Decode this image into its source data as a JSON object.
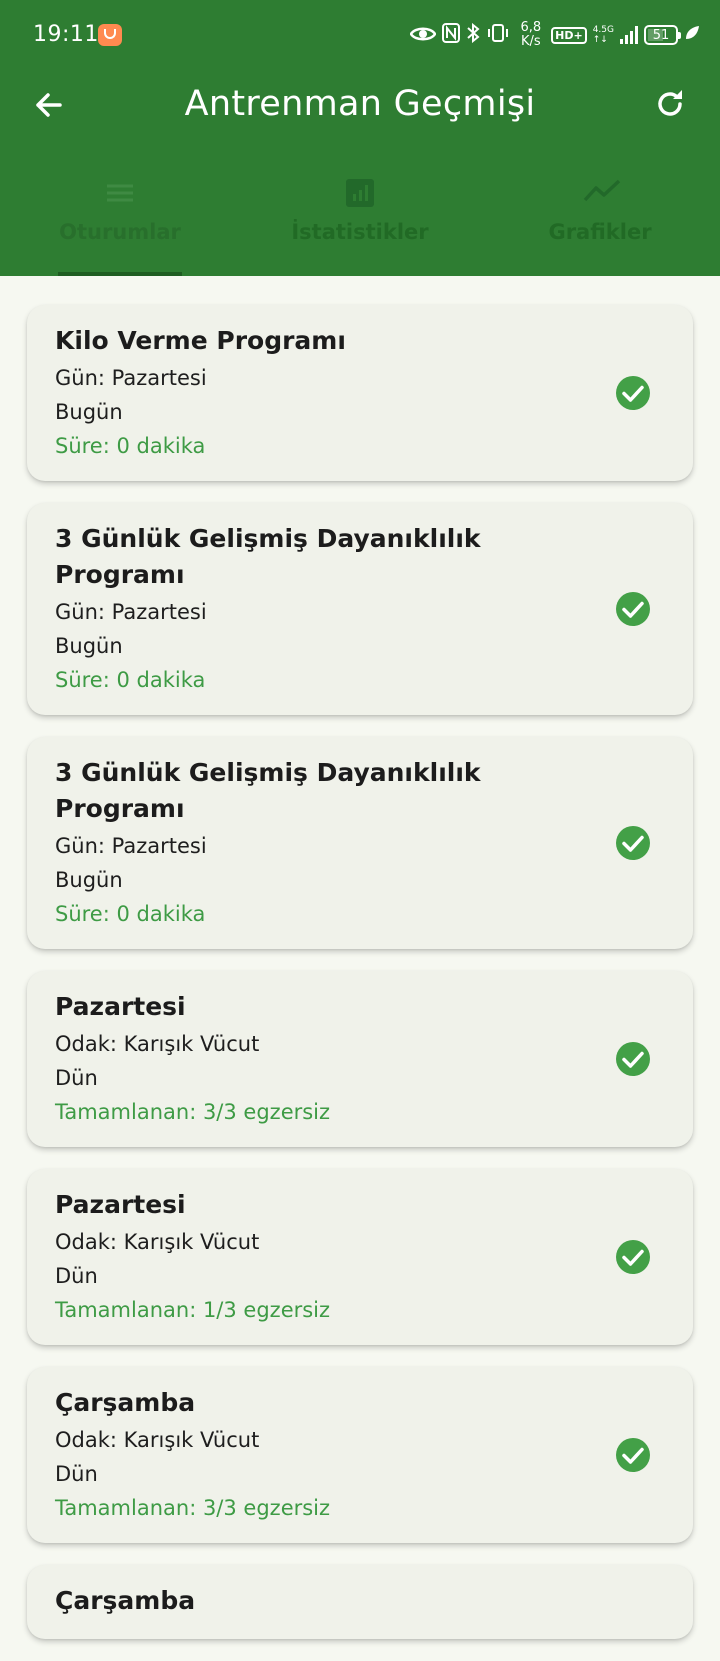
{
  "status_bar": {
    "time": "19:11",
    "speed_value": "6,8",
    "speed_unit": "K/s",
    "hd": "HD+",
    "network_top": "4.5G",
    "network_bottom": "↑↓",
    "battery": "51"
  },
  "header": {
    "title": "Antrenman Geçmişi",
    "back_icon": "arrow-back-icon",
    "refresh_icon": "refresh-icon",
    "background": "#2e7d32"
  },
  "tabs": [
    {
      "label": "Oturumlar",
      "icon": "list-icon",
      "selected": true
    },
    {
      "label": "İstatistikler",
      "icon": "bar-chart-icon",
      "selected": false
    },
    {
      "label": "Grafikler",
      "icon": "trend-line-icon",
      "selected": false
    }
  ],
  "sessions": [
    {
      "title": "Kilo Verme Programı",
      "line1": "Gün: Pazartesi",
      "line2": "Bugün",
      "detail": "Süre: 0 dakika",
      "completed": true
    },
    {
      "title": "3 Günlük Gelişmiş Dayanıklılık Programı",
      "line1": "Gün: Pazartesi",
      "line2": "Bugün",
      "detail": "Süre: 0 dakika",
      "completed": true
    },
    {
      "title": "3 Günlük Gelişmiş Dayanıklılık Programı",
      "line1": "Gün: Pazartesi",
      "line2": "Bugün",
      "detail": "Süre: 0 dakika",
      "completed": true
    },
    {
      "title": "Pazartesi",
      "line1": "Odak: Karışık Vücut",
      "line2": "Dün",
      "detail": "Tamamlanan: 3/3 egzersiz",
      "completed": true
    },
    {
      "title": "Pazartesi",
      "line1": "Odak: Karışık Vücut",
      "line2": "Dün",
      "detail": "Tamamlanan: 1/3 egzersiz",
      "completed": true
    },
    {
      "title": "Çarşamba",
      "line1": "Odak: Karışık Vücut",
      "line2": "Dün",
      "detail": "Tamamlanan: 3/3 egzersiz",
      "completed": true
    },
    {
      "title": "Çarşamba",
      "line1": "",
      "line2": "",
      "detail": "",
      "completed": true
    }
  ],
  "colors": {
    "accent_green": "#3e9b45",
    "check_green": "#43a047",
    "card_bg": "#f0f2ea",
    "page_bg": "#f6f8f1"
  }
}
